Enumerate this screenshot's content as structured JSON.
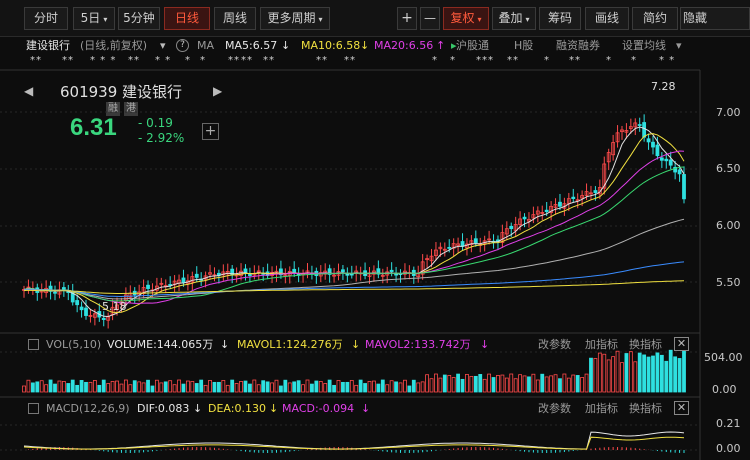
{
  "toolbar": {
    "tabs": [
      {
        "label": "分时"
      },
      {
        "label": "5日",
        "caret": "▾"
      },
      {
        "label": "5分钟"
      },
      {
        "label": "日线"
      },
      {
        "label": "周线"
      },
      {
        "label": "更多周期",
        "caret": "▾"
      }
    ],
    "plus": "+",
    "minus": "—",
    "fuquan": {
      "label": "复权",
      "caret": "▾"
    },
    "diejia": {
      "label": "叠加",
      "caret": "▾"
    },
    "chouma": "筹码",
    "huaxian": "画线",
    "jianyue": "简约",
    "yincang": "隐藏"
  },
  "info": {
    "name": "建设银行",
    "period": "(日线,前复权)",
    "ma_label": "MA",
    "ma5": "MA5:6.57",
    "ma10": "MA10:6.58",
    "ma20": "MA20:6.56",
    "hugu": "沪股通",
    "hgu": "H股",
    "rongzi": "融资融券",
    "setting": "设置均线",
    "down": "↓",
    "up": "↑",
    "caret": "▾",
    "hgu_arrow": "▸",
    "colors": {
      "ma5": "#e8e8e8",
      "ma10": "#f0e040",
      "ma20": "#e040e8",
      "hugu": "#39c86a"
    }
  },
  "markers": {
    "groups": [
      "**",
      "**",
      "* * *",
      "**",
      "* *",
      "*",
      "*",
      "**",
      "**",
      "**",
      "**",
      "**",
      "***",
      "**",
      "**",
      "* *",
      "*",
      "**",
      "* *",
      "**",
      "**",
      "* *",
      "**",
      "**",
      "*",
      "**",
      "* *",
      "**",
      "**",
      "**"
    ]
  },
  "quote": {
    "name": "601939 建设银行",
    "prev": "◀",
    "next": "▶",
    "rong": "融",
    "gang": "港",
    "price": "6.31",
    "change": "- 0.19",
    "change_pct": "- 2.92%",
    "add": "+"
  },
  "chart_data": [
    {
      "type": "line",
      "name": "price-candles",
      "y_axis_labels": [
        "7.00",
        "6.50",
        "6.00",
        "5.50"
      ],
      "ylim": [
        5.2,
        7.4
      ],
      "annotations": [
        {
          "text": "7.28",
          "note": "high"
        },
        {
          "text": "5.18",
          "note": "low"
        }
      ],
      "last_close": 6.31,
      "series": [
        {
          "color": "#e0e0e0"
        },
        {
          "color": "#f0e040"
        },
        {
          "color": "#e040e8"
        },
        {
          "color": "#39d870"
        },
        {
          "color": "#b0b0b0"
        },
        {
          "color": "#3a8cff"
        },
        {
          "color": "#f0e040"
        }
      ]
    },
    {
      "type": "bar",
      "name": "volume",
      "y_axis_labels": [
        "504.00",
        "0.00"
      ]
    },
    {
      "type": "line",
      "name": "macd",
      "y_axis_labels": [
        "0.21",
        "0.00"
      ]
    }
  ],
  "vol": {
    "label": "VOL(5,10)",
    "volume": "VOLUME:144.065万",
    "mavol1": "MAVOL1:124.276万",
    "mavol2": "MAVOL2:133.742万",
    "down": "↓",
    "gaicanshu": "改参数",
    "jiazhibiao": "加指标",
    "huanzhibiao": "换指标",
    "close": "✕"
  },
  "macd": {
    "label": "MACD(12,26,9)",
    "dif": "DIF:0.083",
    "dea": "DEA:0.130",
    "macd": "MACD:-0.094",
    "down": "↓",
    "gaicanshu": "改参数",
    "jiazhibiao": "加指标",
    "huanzhibiao": "换指标",
    "close": "✕"
  }
}
